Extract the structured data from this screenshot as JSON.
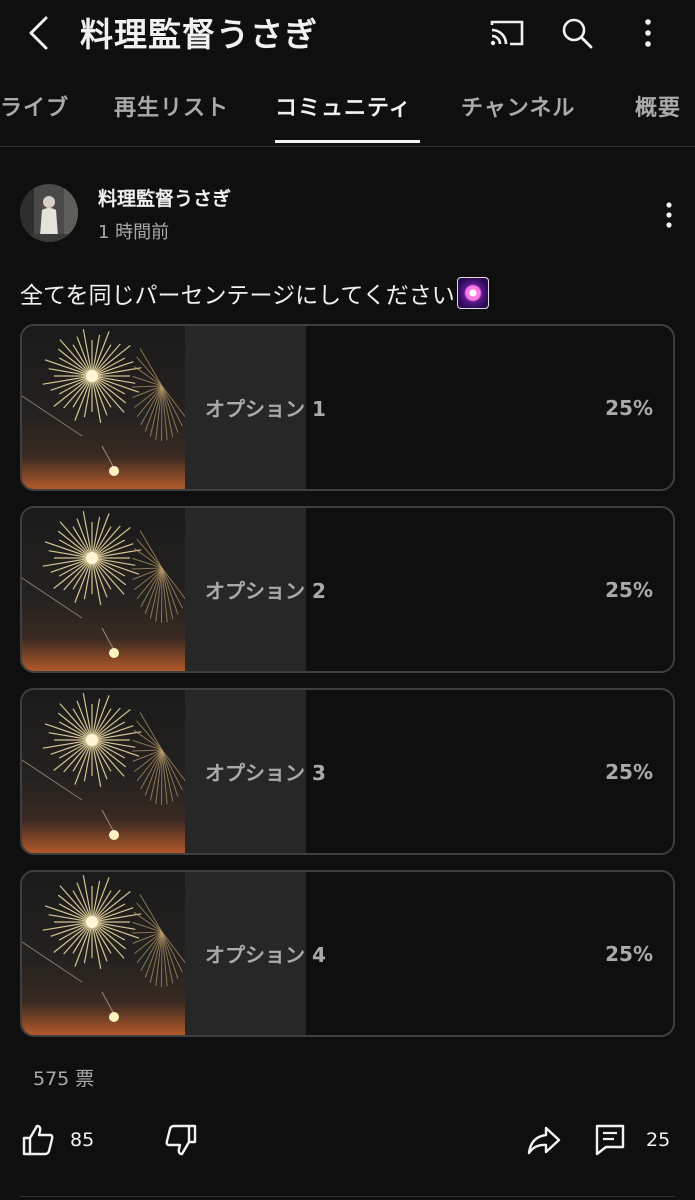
{
  "header": {
    "title": "料理監督うさぎ",
    "back_icon": "back-arrow-icon",
    "icons": [
      "cast-icon",
      "search-icon",
      "more-vert-icon"
    ]
  },
  "tabs": [
    {
      "label": "ライブ",
      "active": false
    },
    {
      "label": "再生リスト",
      "active": false
    },
    {
      "label": "コミュニティ",
      "active": true
    },
    {
      "label": "チャンネル",
      "active": false
    },
    {
      "label": "概要",
      "active": false
    }
  ],
  "post": {
    "author": "料理監督うさぎ",
    "time": "1 時間前",
    "text": "全てを同じパーセンテージにしてください",
    "emoji": "sparkler-emoji"
  },
  "poll": {
    "options": [
      {
        "label": "オプション 1",
        "percent": "25%",
        "fill": 0.25
      },
      {
        "label": "オプション 2",
        "percent": "25%",
        "fill": 0.25
      },
      {
        "label": "オプション 3",
        "percent": "25%",
        "fill": 0.25
      },
      {
        "label": "オプション 4",
        "percent": "25%",
        "fill": 0.25
      }
    ],
    "votes": "575 票"
  },
  "actions": {
    "likes": "85",
    "comments": "25"
  },
  "colors": {
    "background": "#0f0f0f",
    "text": "#f1f1f1",
    "muted": "#aaaaaa",
    "poll_fill": "#272727",
    "poll_border": "#3f3f3f"
  }
}
